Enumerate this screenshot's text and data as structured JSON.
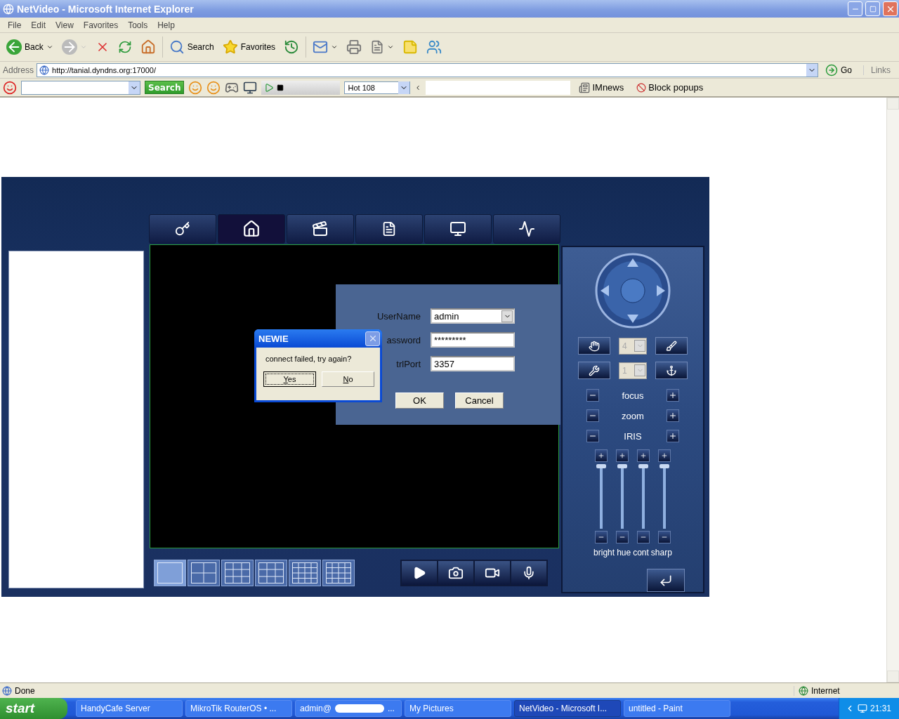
{
  "window": {
    "title": "NetVideo - Microsoft Internet Explorer"
  },
  "menu": [
    "File",
    "Edit",
    "View",
    "Favorites",
    "Tools",
    "Help"
  ],
  "toolbar": {
    "back": "Back",
    "search": "Search",
    "favorites": "Favorites"
  },
  "address_bar": {
    "label": "Address",
    "url": "http://tanial.dyndns.org:17000/",
    "go": "Go",
    "links": "Links"
  },
  "extra_toolbar": {
    "search_button": "Search",
    "station": "Hot 108",
    "imnews": "IMnews",
    "block_popups": "Block popups"
  },
  "app": {
    "tabs": [
      {
        "kind": "key",
        "selected": false
      },
      {
        "kind": "home",
        "selected": true
      },
      {
        "kind": "clapper",
        "selected": false
      },
      {
        "kind": "document",
        "selected": false
      },
      {
        "kind": "monitor",
        "selected": false
      },
      {
        "kind": "pulse",
        "selected": false
      }
    ],
    "login": {
      "fields": [
        {
          "kind": "select",
          "label": "UserName",
          "value": "admin"
        },
        {
          "kind": "password",
          "label": "assword",
          "value": "*********"
        },
        {
          "kind": "text",
          "label": "trlPort",
          "value": "3357"
        }
      ],
      "buttons": [
        "OK",
        "Cancel"
      ]
    },
    "message_box": {
      "title": "NEWIE",
      "text": "connect failed, try again?",
      "buttons": [
        {
          "label": "Yes",
          "selected": true
        },
        {
          "label": "No",
          "selected": false
        }
      ]
    },
    "layouts": [
      {
        "kind": "single"
      },
      {
        "kind": "quad"
      },
      {
        "kind": "six"
      },
      {
        "kind": "nine"
      },
      {
        "kind": "sixteen"
      },
      {
        "kind": "thirteen"
      }
    ],
    "actions": [
      {
        "kind": "play"
      },
      {
        "kind": "camera"
      },
      {
        "kind": "record"
      },
      {
        "kind": "mic"
      }
    ],
    "ptz": {
      "selects": [
        {
          "value": "4",
          "disabled": true
        },
        {
          "value": "1",
          "disabled": true
        }
      ],
      "adjust": [
        "focus",
        "zoom",
        "IRIS"
      ],
      "sliders": [
        {
          "label": "bright",
          "level": 1
        },
        {
          "label": "hue",
          "level": 1
        },
        {
          "label": "cont",
          "level": 1
        },
        {
          "label": "sharp",
          "level": 1
        }
      ]
    }
  },
  "status_bar": {
    "text": "Done",
    "zone": "Internet"
  },
  "taskbar": {
    "start": "start",
    "clock": "21:31",
    "tasks": [
      {
        "label": "HandyCafe Server",
        "selected": false
      },
      {
        "label": "MikroTik RouterOS • ...",
        "selected": false
      },
      {
        "label": "admin@",
        "tail": "...",
        "selected": false
      },
      {
        "label": "My Pictures",
        "selected": false
      },
      {
        "label": "NetVideo - Microsoft I...",
        "selected": true
      },
      {
        "label": "untitled - Paint",
        "selected": false
      }
    ]
  }
}
